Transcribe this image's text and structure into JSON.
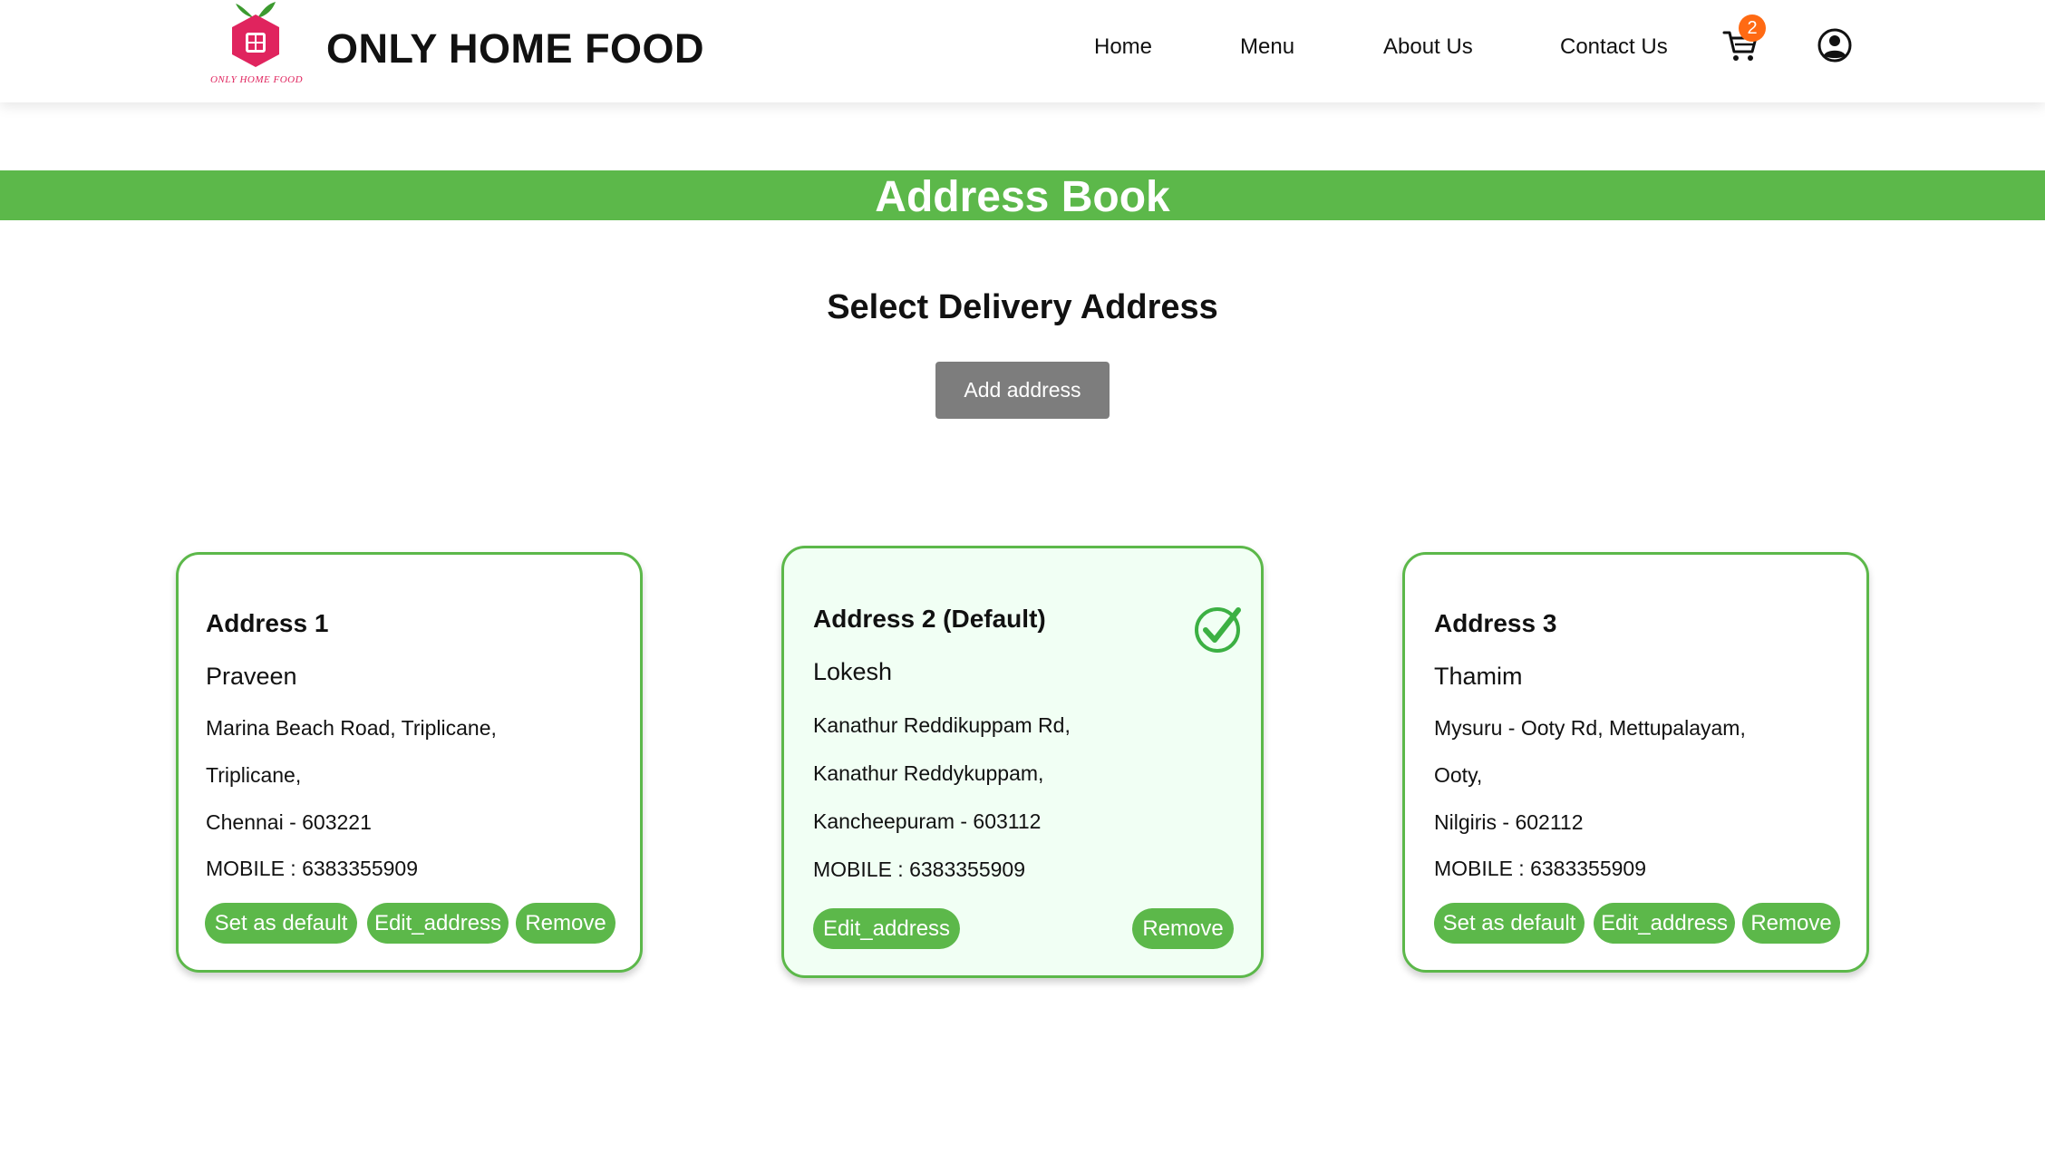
{
  "header": {
    "logo_caption": "ONLY HOME FOOD",
    "brand": "ONLY HOME FOOD",
    "nav": [
      "Home",
      "Menu",
      "About Us",
      "Contact Us"
    ],
    "cart_icon": "cart-icon",
    "cart_count": "2",
    "profile_icon": "user-circle-icon"
  },
  "banner": {
    "title": "Address Book"
  },
  "main": {
    "subtitle": "Select Delivery Address",
    "add_button": "Add address"
  },
  "addresses": [
    {
      "title": "Address 1",
      "name": "Praveen",
      "line1": "Marina Beach Road, Triplicane,",
      "line2": "Triplicane,",
      "line3": "Chennai - 603221",
      "mobile": "MOBILE : 6383355909",
      "set_default": "Set as default",
      "edit": "Edit_address",
      "remove": "Remove"
    },
    {
      "title": "Address 2 (Default)",
      "name": "Lokesh",
      "line1": "Kanathur Reddikuppam Rd,",
      "line2": "Kanathur Reddykuppam,",
      "line3": "Kancheepuram - 603112",
      "mobile": "MOBILE : 6383355909",
      "edit": "Edit_address",
      "remove": "Remove",
      "default_icon": "check-circle-icon"
    },
    {
      "title": "Address 3",
      "name": "Thamim",
      "line1": "Mysuru - Ooty Rd, Mettupalayam,",
      "line2": "Ooty,",
      "line3": "Nilgiris - 602112",
      "mobile": "MOBILE : 6383355909",
      "set_default": "Set as default",
      "edit": "Edit_address",
      "remove": "Remove"
    }
  ],
  "colors": {
    "accent_green": "#5cb84a",
    "button_gray": "#7d7d7d",
    "badge_orange": "#ff6a13",
    "logo_pink": "#e0245e",
    "default_card_bg": "#f1fff4"
  }
}
